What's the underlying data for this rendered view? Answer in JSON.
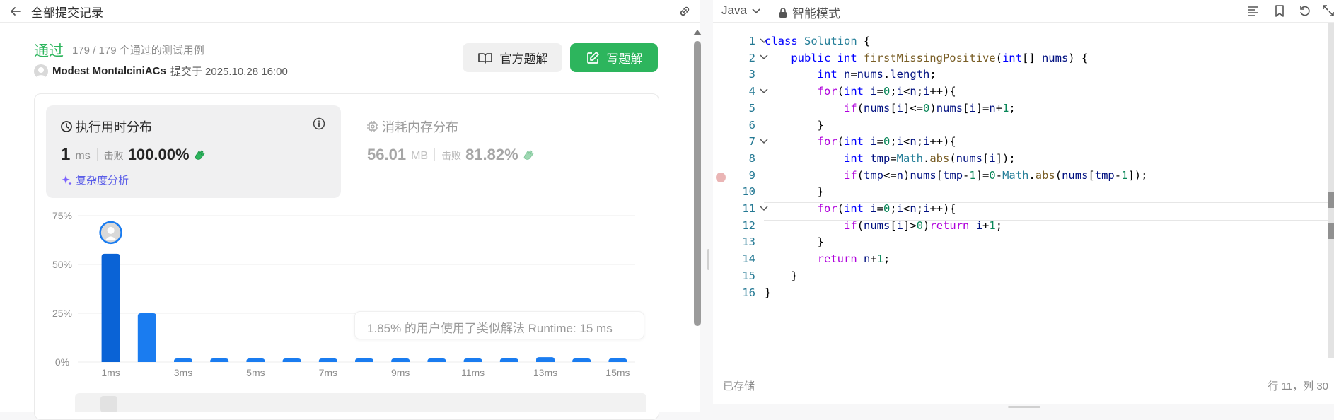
{
  "left_header": {
    "back_label": "全部提交记录"
  },
  "submission": {
    "status": "通过",
    "test_summary": "179 / 179 个通过的测试用例",
    "author": "Modest MontalciniACs",
    "submitted_at": "提交于 2025.10.28 16:00",
    "official_solution_label": "官方题解",
    "write_solution_label": "写题解"
  },
  "runtime": {
    "title": "执行用时分布",
    "value": "1",
    "unit": "ms",
    "beats_label": "击败",
    "beats_value": "100.00%",
    "complexity_link": "复杂度分析"
  },
  "memory": {
    "title": "消耗内存分布",
    "value": "56.01",
    "unit": "MB",
    "beats_label": "击败",
    "beats_value": "81.82%"
  },
  "tooltip": "1.85% 的用户使用了类似解法 Runtime: 15 ms",
  "chart_data": {
    "type": "bar",
    "categories": [
      "1ms",
      "2ms",
      "3ms",
      "4ms",
      "5ms",
      "6ms",
      "7ms",
      "8ms",
      "9ms",
      "10ms",
      "11ms",
      "12ms",
      "13ms",
      "14ms",
      "15ms"
    ],
    "tick_labels": [
      "1ms",
      "",
      "3ms",
      "",
      "5ms",
      "",
      "7ms",
      "",
      "9ms",
      "",
      "11ms",
      "",
      "13ms",
      "",
      "15ms"
    ],
    "values": [
      55.5,
      25,
      1.5,
      1.5,
      1.5,
      1.5,
      1.5,
      1.5,
      1.5,
      1.5,
      1.5,
      1.5,
      2.5,
      1.5,
      1.5
    ],
    "highlight_index": 0,
    "ylim": [
      0,
      75
    ],
    "yticks": [
      "0%",
      "25%",
      "50%",
      "75%"
    ],
    "grid": true,
    "colors": {
      "bar": "#1a7cf0",
      "highlight": "#0a63d6"
    }
  },
  "editor_header": {
    "language": "Java",
    "mode": "智能模式"
  },
  "code_lines": [
    {
      "n": "1",
      "fold": "v",
      "segs": [
        [
          "kw",
          "class "
        ],
        [
          "cls",
          "Solution "
        ],
        [
          "plain",
          "{"
        ]
      ]
    },
    {
      "n": "2",
      "fold": "v",
      "segs": [
        [
          "plain",
          "    "
        ],
        [
          "kw",
          "public "
        ],
        [
          "ty",
          "int "
        ],
        [
          "fn",
          "firstMissingPositive"
        ],
        [
          "plain",
          "("
        ],
        [
          "ty",
          "int"
        ],
        [
          "plain",
          "[] "
        ],
        [
          "var",
          "nums"
        ],
        [
          "plain",
          ") {"
        ]
      ]
    },
    {
      "n": "3",
      "fold": "",
      "segs": [
        [
          "plain",
          "        "
        ],
        [
          "ty",
          "int "
        ],
        [
          "var",
          "n"
        ],
        [
          "plain",
          "="
        ],
        [
          "var",
          "nums"
        ],
        [
          "plain",
          "."
        ],
        [
          "var",
          "length"
        ],
        [
          "plain",
          ";"
        ]
      ]
    },
    {
      "n": "4",
      "fold": "v",
      "segs": [
        [
          "plain",
          "        "
        ],
        [
          "ctl",
          "for"
        ],
        [
          "plain",
          "("
        ],
        [
          "ty",
          "int "
        ],
        [
          "var",
          "i"
        ],
        [
          "plain",
          "="
        ],
        [
          "num",
          "0"
        ],
        [
          "plain",
          ";"
        ],
        [
          "var",
          "i"
        ],
        [
          "plain",
          "<"
        ],
        [
          "var",
          "n"
        ],
        [
          "plain",
          ";"
        ],
        [
          "var",
          "i"
        ],
        [
          "plain",
          "++){"
        ]
      ]
    },
    {
      "n": "5",
      "fold": "",
      "segs": [
        [
          "plain",
          "            "
        ],
        [
          "ctl",
          "if"
        ],
        [
          "plain",
          "("
        ],
        [
          "var",
          "nums"
        ],
        [
          "plain",
          "["
        ],
        [
          "var",
          "i"
        ],
        [
          "plain",
          "]<="
        ],
        [
          "num",
          "0"
        ],
        [
          "plain",
          ")"
        ],
        [
          "var",
          "nums"
        ],
        [
          "plain",
          "["
        ],
        [
          "var",
          "i"
        ],
        [
          "plain",
          "]="
        ],
        [
          "var",
          "n"
        ],
        [
          "plain",
          "+"
        ],
        [
          "num",
          "1"
        ],
        [
          "plain",
          ";"
        ]
      ]
    },
    {
      "n": "6",
      "fold": "",
      "segs": [
        [
          "plain",
          "        }"
        ]
      ]
    },
    {
      "n": "7",
      "fold": "v",
      "segs": [
        [
          "plain",
          "        "
        ],
        [
          "ctl",
          "for"
        ],
        [
          "plain",
          "("
        ],
        [
          "ty",
          "int "
        ],
        [
          "var",
          "i"
        ],
        [
          "plain",
          "="
        ],
        [
          "num",
          "0"
        ],
        [
          "plain",
          ";"
        ],
        [
          "var",
          "i"
        ],
        [
          "plain",
          "<"
        ],
        [
          "var",
          "n"
        ],
        [
          "plain",
          ";"
        ],
        [
          "var",
          "i"
        ],
        [
          "plain",
          "++){"
        ]
      ]
    },
    {
      "n": "8",
      "fold": "",
      "segs": [
        [
          "plain",
          "            "
        ],
        [
          "ty",
          "int "
        ],
        [
          "var",
          "tmp"
        ],
        [
          "plain",
          "="
        ],
        [
          "cls",
          "Math"
        ],
        [
          "plain",
          "."
        ],
        [
          "fn",
          "abs"
        ],
        [
          "plain",
          "("
        ],
        [
          "var",
          "nums"
        ],
        [
          "plain",
          "["
        ],
        [
          "var",
          "i"
        ],
        [
          "plain",
          "]);"
        ]
      ]
    },
    {
      "n": "9",
      "fold": "",
      "segs": [
        [
          "plain",
          "            "
        ],
        [
          "ctl",
          "if"
        ],
        [
          "plain",
          "("
        ],
        [
          "var",
          "tmp"
        ],
        [
          "plain",
          "<="
        ],
        [
          "var",
          "n"
        ],
        [
          "plain",
          ")"
        ],
        [
          "var",
          "nums"
        ],
        [
          "plain",
          "["
        ],
        [
          "var",
          "tmp"
        ],
        [
          "plain",
          "-"
        ],
        [
          "num",
          "1"
        ],
        [
          "plain",
          "]="
        ],
        [
          "num",
          "0"
        ],
        [
          "plain",
          "-"
        ],
        [
          "cls",
          "Math"
        ],
        [
          "plain",
          "."
        ],
        [
          "fn",
          "abs"
        ],
        [
          "plain",
          "("
        ],
        [
          "var",
          "nums"
        ],
        [
          "plain",
          "["
        ],
        [
          "var",
          "tmp"
        ],
        [
          "plain",
          "-"
        ],
        [
          "num",
          "1"
        ],
        [
          "plain",
          "]);"
        ]
      ]
    },
    {
      "n": "10",
      "fold": "",
      "segs": [
        [
          "plain",
          "        }"
        ]
      ]
    },
    {
      "n": "11",
      "fold": "v",
      "segs": [
        [
          "plain",
          "        "
        ],
        [
          "ctl",
          "for"
        ],
        [
          "plain",
          "("
        ],
        [
          "ty",
          "int "
        ],
        [
          "var",
          "i"
        ],
        [
          "plain",
          "="
        ],
        [
          "num",
          "0"
        ],
        [
          "plain",
          ";"
        ],
        [
          "var",
          "i"
        ],
        [
          "plain",
          "<"
        ],
        [
          "var",
          "n"
        ],
        [
          "plain",
          ";"
        ],
        [
          "var",
          "i"
        ],
        [
          "plain",
          "++){"
        ]
      ]
    },
    {
      "n": "12",
      "fold": "",
      "segs": [
        [
          "plain",
          "            "
        ],
        [
          "ctl",
          "if"
        ],
        [
          "plain",
          "("
        ],
        [
          "var",
          "nums"
        ],
        [
          "plain",
          "["
        ],
        [
          "var",
          "i"
        ],
        [
          "plain",
          "]>"
        ],
        [
          "num",
          "0"
        ],
        [
          "plain",
          ")"
        ],
        [
          "ctl",
          "return "
        ],
        [
          "var",
          "i"
        ],
        [
          "plain",
          "+"
        ],
        [
          "num",
          "1"
        ],
        [
          "plain",
          ";"
        ]
      ]
    },
    {
      "n": "13",
      "fold": "",
      "segs": [
        [
          "plain",
          "        }"
        ]
      ]
    },
    {
      "n": "14",
      "fold": "",
      "segs": [
        [
          "plain",
          "        "
        ],
        [
          "ctl",
          "return "
        ],
        [
          "var",
          "n"
        ],
        [
          "plain",
          "+"
        ],
        [
          "num",
          "1"
        ],
        [
          "plain",
          ";"
        ]
      ]
    },
    {
      "n": "15",
      "fold": "",
      "segs": [
        [
          "plain",
          "    }"
        ]
      ]
    },
    {
      "n": "16",
      "fold": "",
      "segs": [
        [
          "plain",
          "}"
        ]
      ]
    }
  ],
  "status_bar": {
    "saved": "已存储",
    "cursor": "行 11，列 30"
  }
}
